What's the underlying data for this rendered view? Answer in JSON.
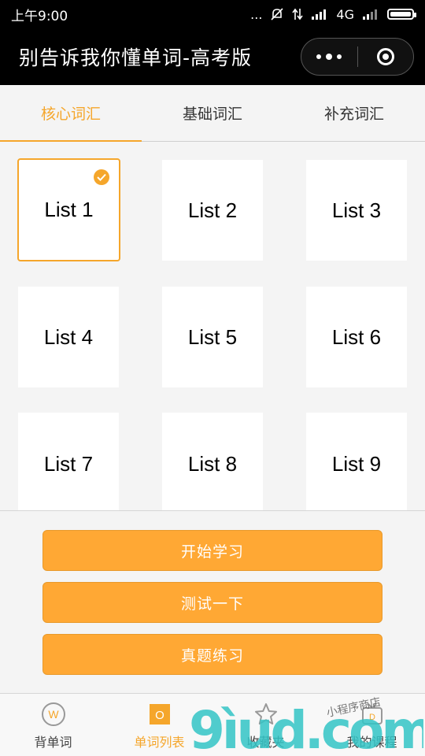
{
  "status_bar": {
    "time": "上午9:00",
    "network": "4G",
    "dots": "..."
  },
  "header": {
    "title": "别告诉我你懂单词-高考版"
  },
  "tabs": [
    {
      "label": "核心词汇",
      "active": true
    },
    {
      "label": "基础词汇",
      "active": false
    },
    {
      "label": "补充词汇",
      "active": false
    }
  ],
  "lists": [
    {
      "label": "List 1",
      "selected": true
    },
    {
      "label": "List 2",
      "selected": false
    },
    {
      "label": "List 3",
      "selected": false
    },
    {
      "label": "List 4",
      "selected": false
    },
    {
      "label": "List 5",
      "selected": false
    },
    {
      "label": "List 6",
      "selected": false
    },
    {
      "label": "List 7",
      "selected": false
    },
    {
      "label": "List 8",
      "selected": false
    },
    {
      "label": "List 9",
      "selected": false
    }
  ],
  "actions": {
    "start": "开始学习",
    "test": "测试一下",
    "exam": "真题练习"
  },
  "tabbar": [
    {
      "label": "背单词",
      "icon": "w-circle-icon",
      "icon_text": "W",
      "active": false
    },
    {
      "label": "单词列表",
      "icon": "list-square-icon",
      "icon_text": "O",
      "active": true
    },
    {
      "label": "收藏夹",
      "icon": "star-icon",
      "active": false
    },
    {
      "label": "我的课程",
      "icon": "tv-icon",
      "icon_text": "D",
      "active": false
    }
  ],
  "watermark": {
    "text": "9ìud.com",
    "subtext": "小程序商店"
  },
  "colors": {
    "accent": "#f5a62b",
    "button": "#ffa834",
    "topbar": "#000000",
    "background": "#f4f4f4"
  }
}
